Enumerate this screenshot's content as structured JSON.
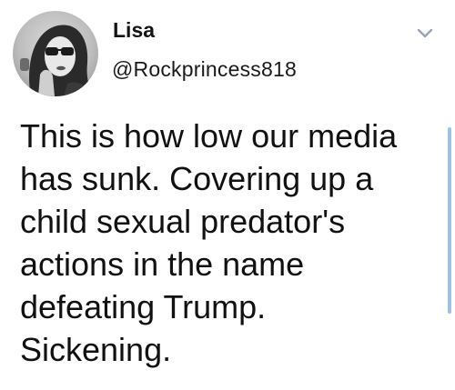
{
  "tweet": {
    "author": {
      "display_name": "Lisa",
      "handle": "@Rockprincess818",
      "avatar_icon": "profile-photo"
    },
    "menu_icon": "chevron-down-icon",
    "text_lines": [
      "This is how low our media",
      "has sunk. Covering up a",
      "child sexual predator's",
      "actions in the name",
      "defeating Trump.",
      "Sickening."
    ]
  },
  "colors": {
    "text": "#111111",
    "caret": "#9aa5b1",
    "scrollbar": "#9cc3e6"
  }
}
